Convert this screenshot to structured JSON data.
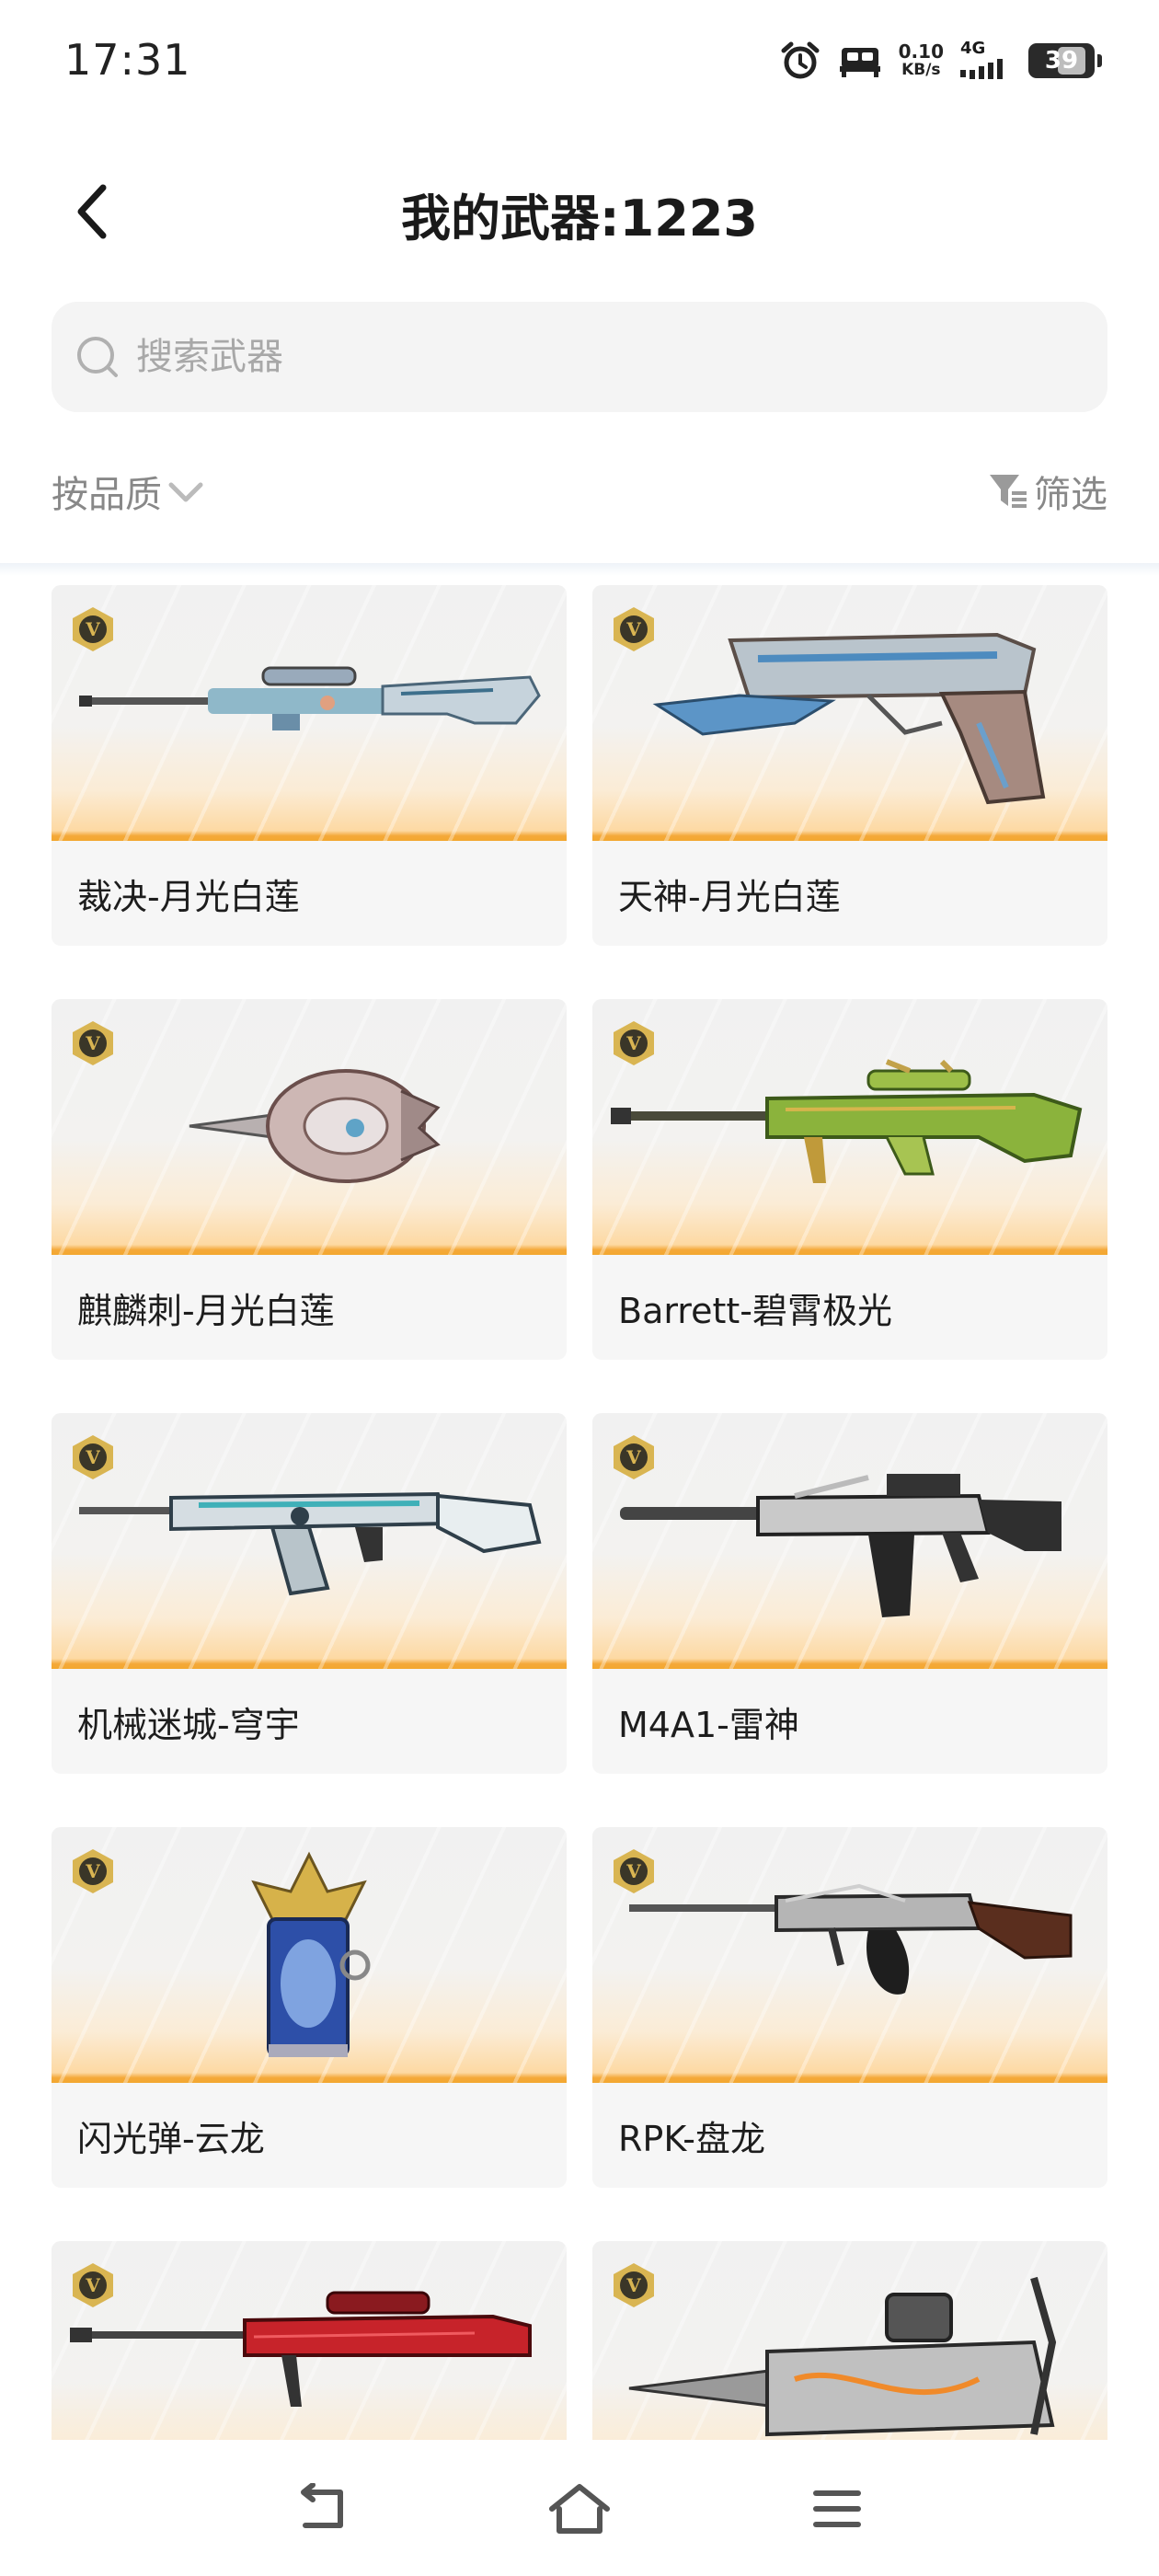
{
  "status_bar": {
    "time": "17:31",
    "speed_value": "0.10",
    "speed_unit": "KB/s",
    "network": "4G",
    "battery": "39"
  },
  "header": {
    "title": "我的武器:1223"
  },
  "search": {
    "placeholder": "搜索武器"
  },
  "toolbar": {
    "sort_label": "按品质",
    "filter_label": "筛选"
  },
  "weapons": [
    {
      "name": "裁决-月光白莲",
      "badge": "V"
    },
    {
      "name": "天神-月光白莲",
      "badge": "V"
    },
    {
      "name": "麒麟刺-月光白莲",
      "badge": "V"
    },
    {
      "name": "Barrett-碧霄极光",
      "badge": "V"
    },
    {
      "name": "机械迷城-穹宇",
      "badge": "V"
    },
    {
      "name": "M4A1-雷神",
      "badge": "V"
    },
    {
      "name": "闪光弹-云龙",
      "badge": "V"
    },
    {
      "name": "RPK-盘龙",
      "badge": "V"
    },
    {
      "name": "",
      "badge": "V"
    },
    {
      "name": "",
      "badge": "V"
    }
  ],
  "colors": {
    "accent_orange": "#f3a72f",
    "badge_gold": "#d9b552",
    "badge_dark": "#3a3628"
  }
}
